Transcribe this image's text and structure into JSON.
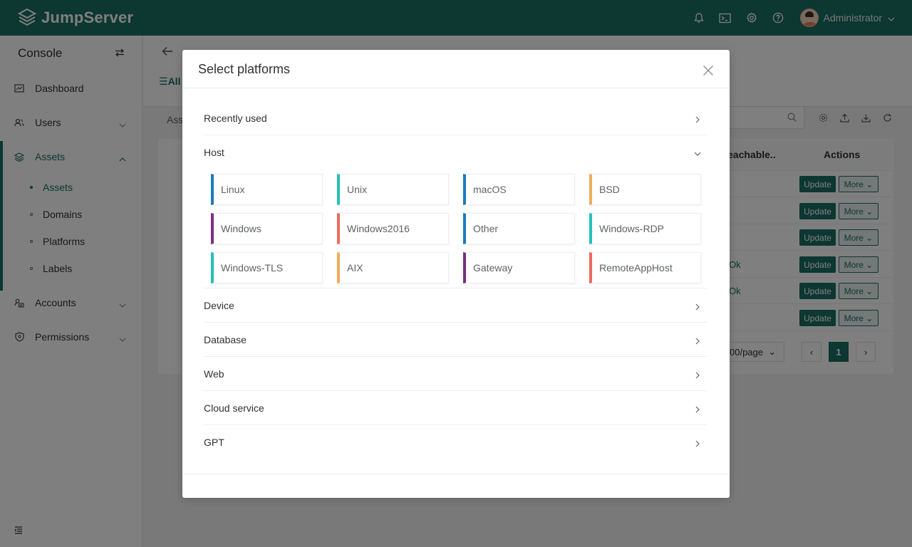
{
  "app": {
    "brand": "JumpServer",
    "user": "Administrator"
  },
  "colors": {
    "brand": "#1a6e63",
    "header_bg": "#1a6e63"
  },
  "topbar_icons": [
    "bell-icon",
    "terminal-icon",
    "settings-icon",
    "help-icon"
  ],
  "sidebar": {
    "title": "Console",
    "items": [
      {
        "label": "Dashboard",
        "icon": "dashboard-icon"
      },
      {
        "label": "Users",
        "icon": "users-icon"
      },
      {
        "label": "Assets",
        "icon": "assets-icon"
      },
      {
        "label": "Accounts",
        "icon": "accounts-icon"
      },
      {
        "label": "Permissions",
        "icon": "permissions-icon"
      }
    ],
    "assets_sub": [
      "Assets",
      "Domains",
      "Platforms",
      "Labels"
    ]
  },
  "page": {
    "tab_all": "All",
    "assets_label": "Ass",
    "col_reachable": "eachable..",
    "col_actions": "Actions",
    "rows": [
      {
        "status": "",
        "update": "Update",
        "more": "More"
      },
      {
        "status": "",
        "update": "Update",
        "more": "More"
      },
      {
        "status": "",
        "update": "Update",
        "more": "More"
      },
      {
        "status": "Ok",
        "update": "Update",
        "more": "More"
      },
      {
        "status": "Ok",
        "update": "Update",
        "more": "More"
      },
      {
        "status": "",
        "update": "Update",
        "more": "More"
      }
    ],
    "page_size": "00/page",
    "current_page": "1"
  },
  "modal": {
    "title": "Select platforms",
    "categories": {
      "recent": "Recently used",
      "host": "Host",
      "device": "Device",
      "database": "Database",
      "web": "Web",
      "cloud": "Cloud service",
      "gpt": "GPT"
    },
    "host_platforms": [
      {
        "name": "Linux",
        "color": "#1b7cc0"
      },
      {
        "name": "Unix",
        "color": "#25c0b8"
      },
      {
        "name": "macOS",
        "color": "#1b7cc0"
      },
      {
        "name": "BSD",
        "color": "#f0ad5b"
      },
      {
        "name": "Windows",
        "color": "#7a2f86"
      },
      {
        "name": "Windows2016",
        "color": "#ec6a5e"
      },
      {
        "name": "Other",
        "color": "#1b7cc0"
      },
      {
        "name": "Windows-RDP",
        "color": "#25c0b8"
      },
      {
        "name": "Windows-TLS",
        "color": "#25c0b8"
      },
      {
        "name": "AIX",
        "color": "#f0ad5b"
      },
      {
        "name": "Gateway",
        "color": "#7a2f86"
      },
      {
        "name": "RemoteAppHost",
        "color": "#ec6a5e"
      }
    ]
  }
}
